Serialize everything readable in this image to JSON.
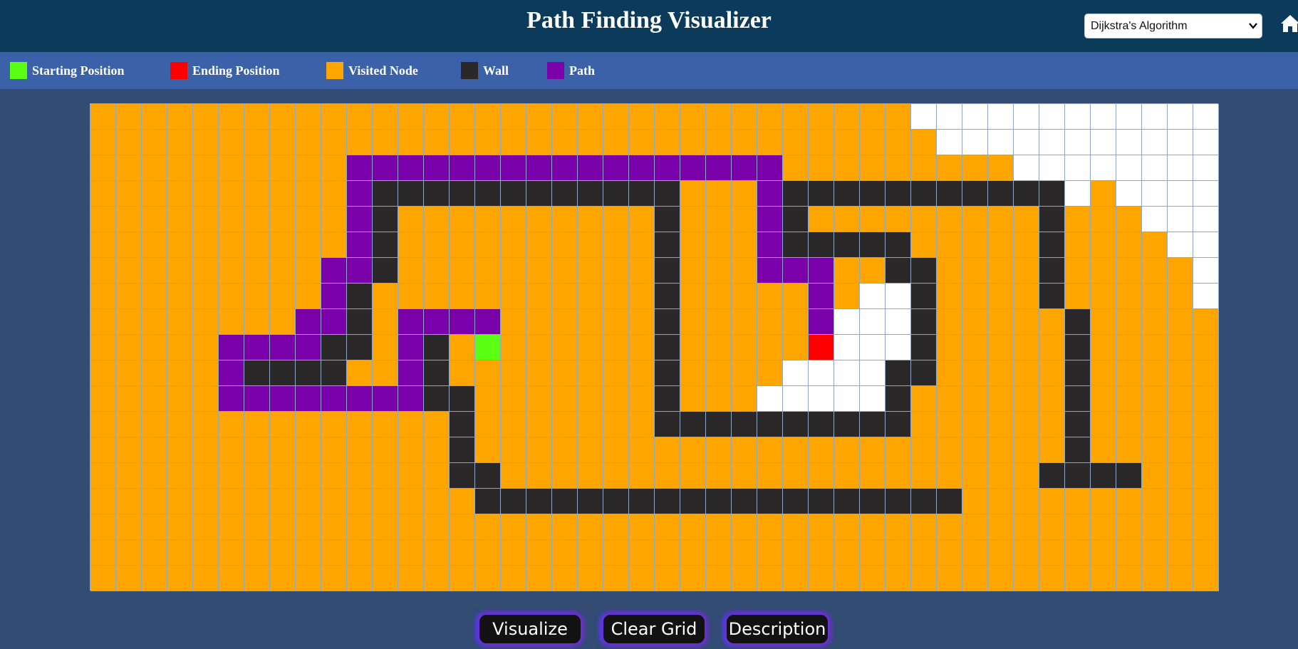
{
  "header": {
    "title": "Path Finding Visualizer"
  },
  "algorithm_select": {
    "selected": "Dijkstra's Algorithm"
  },
  "icons": {
    "home": "home-icon",
    "dropdown": "chevron-down-icon"
  },
  "legend": {
    "items": [
      {
        "label": "Starting Position",
        "color": "#5bff14"
      },
      {
        "label": "Ending Position",
        "color": "#ff0000"
      },
      {
        "label": "Visited Node",
        "color": "#ffa500"
      },
      {
        "label": "Wall",
        "color": "#2b2829"
      },
      {
        "label": "Path",
        "color": "#7a00a9"
      }
    ]
  },
  "colors": {
    "unvisited": "#ffffff",
    "visited": "#ffa500",
    "wall": "#2b2829",
    "path": "#7a00a9",
    "start": "#5bff14",
    "end": "#ff0000"
  },
  "grid": {
    "rows": [
      "................................UUUUUUUUUUUU",
      ".................................UUUUUUUUUUU",
      "..........PPPPPPPPPPPPPPPPP.........UUUUUUUU",
      "..........PWWWWWWWWWWWW...PWWWWWWWWWWWU.UUUU",
      "..........PW..........W...PW.........W...UUU",
      "..........PW..........W...PWWWWW.....W....UU",
      ".........PPW..........W...PPP..WW....W.....U",
      ".........PW...........W.....P.UUW....W.....U",
      "........PPW.PPPP......W.....PUUUW.....W.....",
      ".....PPPPWW.PW.S......W.....EUUUW.....W.....",
      ".....PWWWW..PW........W....UUUUWW.....W.....",
      ".....PPPPPPPPWW.......W...UUUUUW......W.....",
      "..............W.......WWWWWWWWWW......W.....",
      "..............W.......................W.....",
      "..............WW.....................WWWW...",
      "...............WWWWWWWWWWWWWWWWWWW..........",
      "............................................",
      "............................................",
      "............................................"
    ]
  },
  "buttons": {
    "visualize": "Visualize",
    "clear": "Clear Grid",
    "description": "Description"
  }
}
